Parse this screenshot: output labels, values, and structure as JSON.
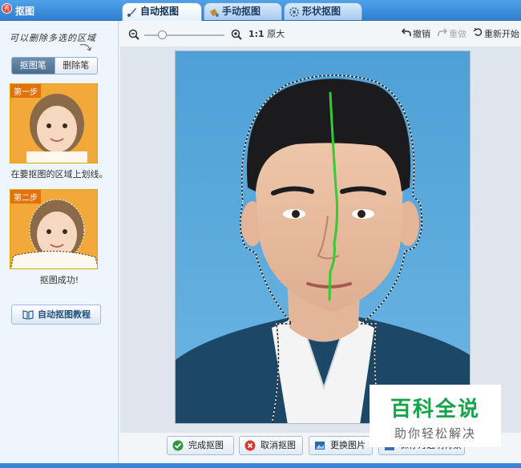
{
  "window": {
    "title": "抠图"
  },
  "tabs": [
    {
      "label": "自动抠图",
      "icon": "brush-icon",
      "active": true
    },
    {
      "label": "手动抠图",
      "icon": "paint-bucket-icon",
      "active": false
    },
    {
      "label": "形状抠图",
      "icon": "gear-shape-icon",
      "active": false
    }
  ],
  "sidebar": {
    "hint": "可以删除多选的区域",
    "brush_label": "抠图笔",
    "eraser_label": "删除笔",
    "step1": {
      "tag": "第一步",
      "caption": "在要抠图的区域上划线。"
    },
    "step2": {
      "tag": "第二步",
      "caption": "抠图成功!"
    },
    "tutorial_label": "自动抠图教程"
  },
  "toolbar": {
    "ratio_label": "1:1",
    "original_size_label": "原大",
    "undo_label": "撤销",
    "redo_label": "重做",
    "restart_label": "重新开始"
  },
  "bottom": {
    "finish_label": "完成抠图",
    "cancel_label": "取消抠图",
    "replace_label": "更换图片",
    "save_label": "保存为透明背景"
  },
  "watermark": {
    "title": "百科全说",
    "subtitle": "助你轻松解决"
  },
  "colors": {
    "accent": "#2f7fd0",
    "photo_bg": "#54a6d8",
    "stroke": "#33cc33",
    "watermark": "#16a34a"
  }
}
